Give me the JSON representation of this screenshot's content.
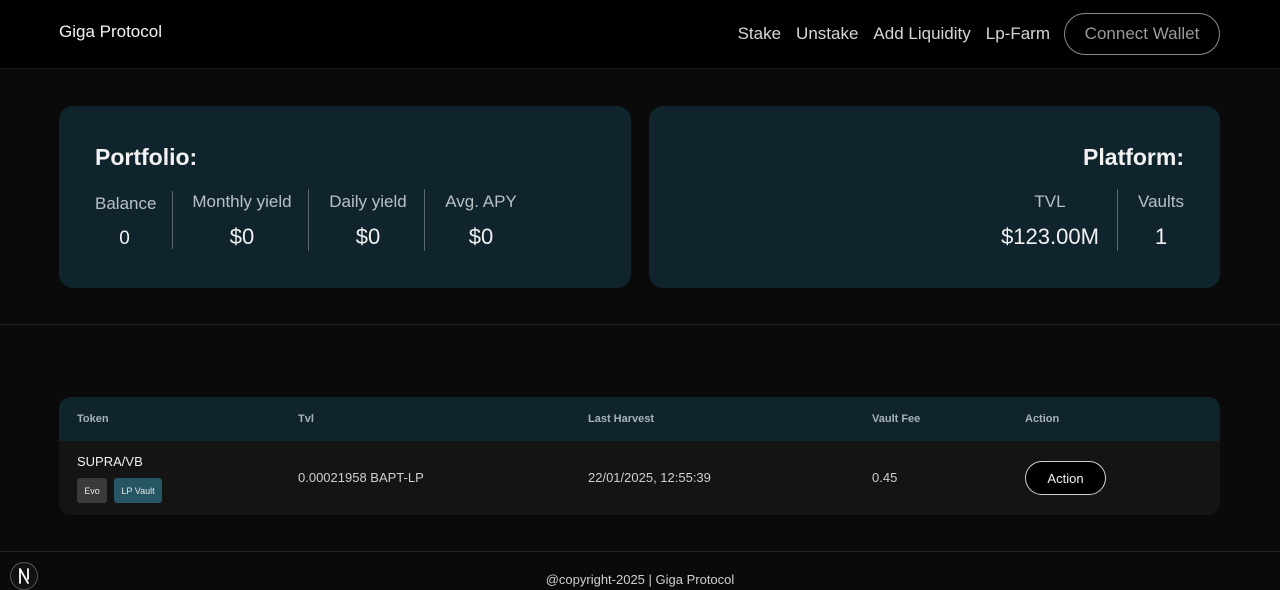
{
  "header": {
    "brand": "Giga Protocol",
    "nav": [
      "Stake",
      "Unstake",
      "Add Liquidity",
      "Lp-Farm"
    ],
    "connect_label": "Connect Wallet"
  },
  "portfolio": {
    "title": "Portfolio:",
    "stats": [
      {
        "label": "Balance",
        "value": "0"
      },
      {
        "label": "Monthly yield",
        "value": "$0"
      },
      {
        "label": "Daily yield",
        "value": "$0"
      },
      {
        "label": "Avg. APY",
        "value": "$0"
      }
    ]
  },
  "platform": {
    "title": "Platform:",
    "stats": [
      {
        "label": "TVL",
        "value": "$123.00M"
      },
      {
        "label": "Vaults",
        "value": "1"
      }
    ]
  },
  "vaults_table": {
    "columns": [
      "Token",
      "Tvl",
      "Last Harvest",
      "Vault Fee",
      "Action"
    ],
    "rows": [
      {
        "token": "SUPRA/VB",
        "tags": [
          "Evo",
          "LP Vault"
        ],
        "tvl": "0.00021958 BAPT-LP",
        "last_harvest": "22/01/2025, 12:55:39",
        "vault_fee": "0.45",
        "action_label": "Action"
      }
    ]
  },
  "footer": {
    "text": "@copyright-2025 | Giga Protocol"
  },
  "corner_badge": {
    "glyph": "N",
    "icon": "lightning-bolt-icon"
  },
  "colors": {
    "background": "#0a0a0a",
    "navbar": "#000000",
    "card": "#10242d",
    "tag_lp": "#265563",
    "tag_evo": "#3a3a3a"
  }
}
